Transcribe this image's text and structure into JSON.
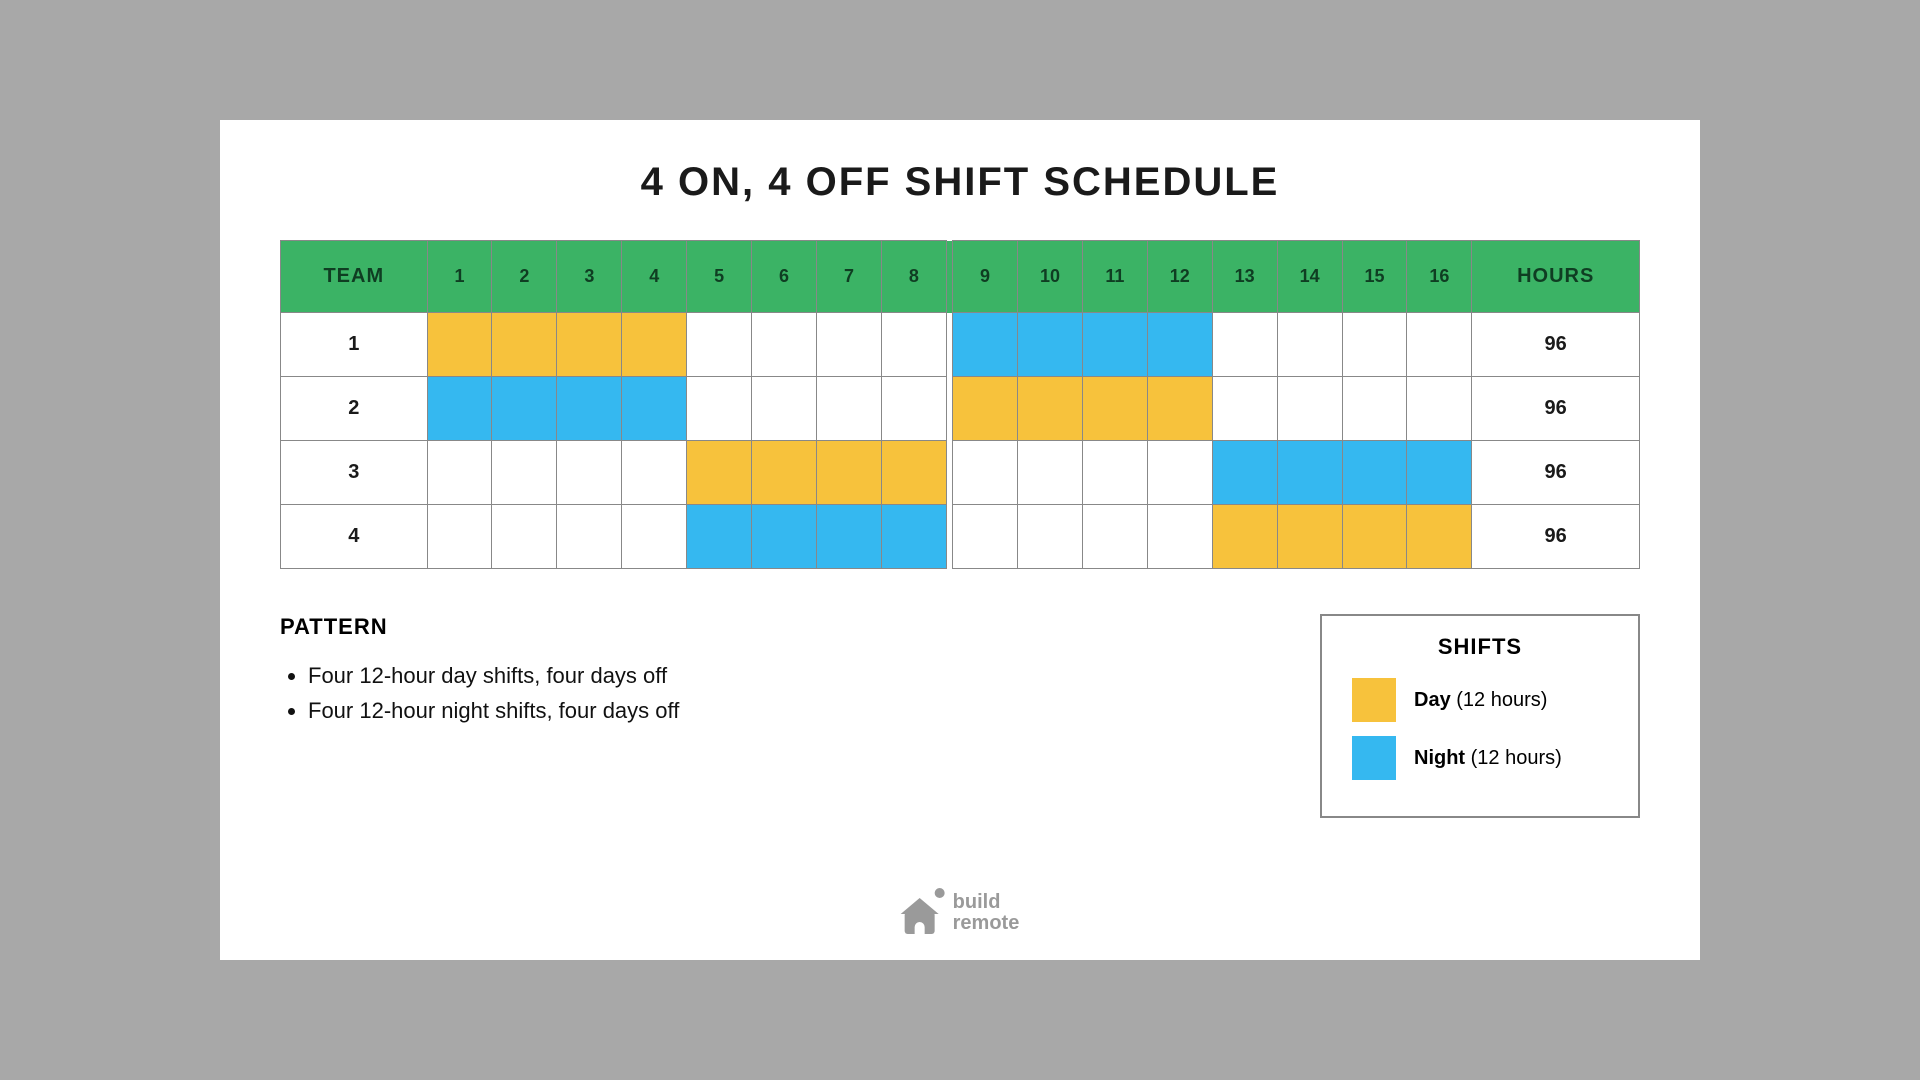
{
  "title": "4 ON, 4 OFF SHIFT SCHEDULE",
  "table": {
    "team_header": "TEAM",
    "hours_header": "HOURS",
    "day_numbers": [
      "1",
      "2",
      "3",
      "4",
      "5",
      "6",
      "7",
      "8",
      "9",
      "10",
      "11",
      "12",
      "13",
      "14",
      "15",
      "16"
    ],
    "rows": [
      {
        "team": "1",
        "days": [
          "day",
          "day",
          "day",
          "day",
          "off",
          "off",
          "off",
          "off",
          "night",
          "night",
          "night",
          "night",
          "off",
          "off",
          "off",
          "off"
        ],
        "hours": "96"
      },
      {
        "team": "2",
        "days": [
          "night",
          "night",
          "night",
          "night",
          "off",
          "off",
          "off",
          "off",
          "day",
          "day",
          "day",
          "day",
          "off",
          "off",
          "off",
          "off"
        ],
        "hours": "96"
      },
      {
        "team": "3",
        "days": [
          "off",
          "off",
          "off",
          "off",
          "day",
          "day",
          "day",
          "day",
          "off",
          "off",
          "off",
          "off",
          "night",
          "night",
          "night",
          "night"
        ],
        "hours": "96"
      },
      {
        "team": "4",
        "days": [
          "off",
          "off",
          "off",
          "off",
          "night",
          "night",
          "night",
          "night",
          "off",
          "off",
          "off",
          "off",
          "day",
          "day",
          "day",
          "day"
        ],
        "hours": "96"
      }
    ]
  },
  "pattern": {
    "header": "PATTERN",
    "items": [
      "Four 12-hour day shifts, four days off",
      "Four 12-hour night shifts, four days off"
    ]
  },
  "legend": {
    "header": "SHIFTS",
    "entries": [
      {
        "kind": "day",
        "bold": "Day",
        "rest": " (12 hours)"
      },
      {
        "kind": "night",
        "bold": "Night",
        "rest": " (12 hours)"
      }
    ]
  },
  "brand": {
    "line1": "build",
    "line2": "remote"
  },
  "colors": {
    "day": "#f7c23c",
    "night": "#35b8f0",
    "header": "#3bb365"
  }
}
